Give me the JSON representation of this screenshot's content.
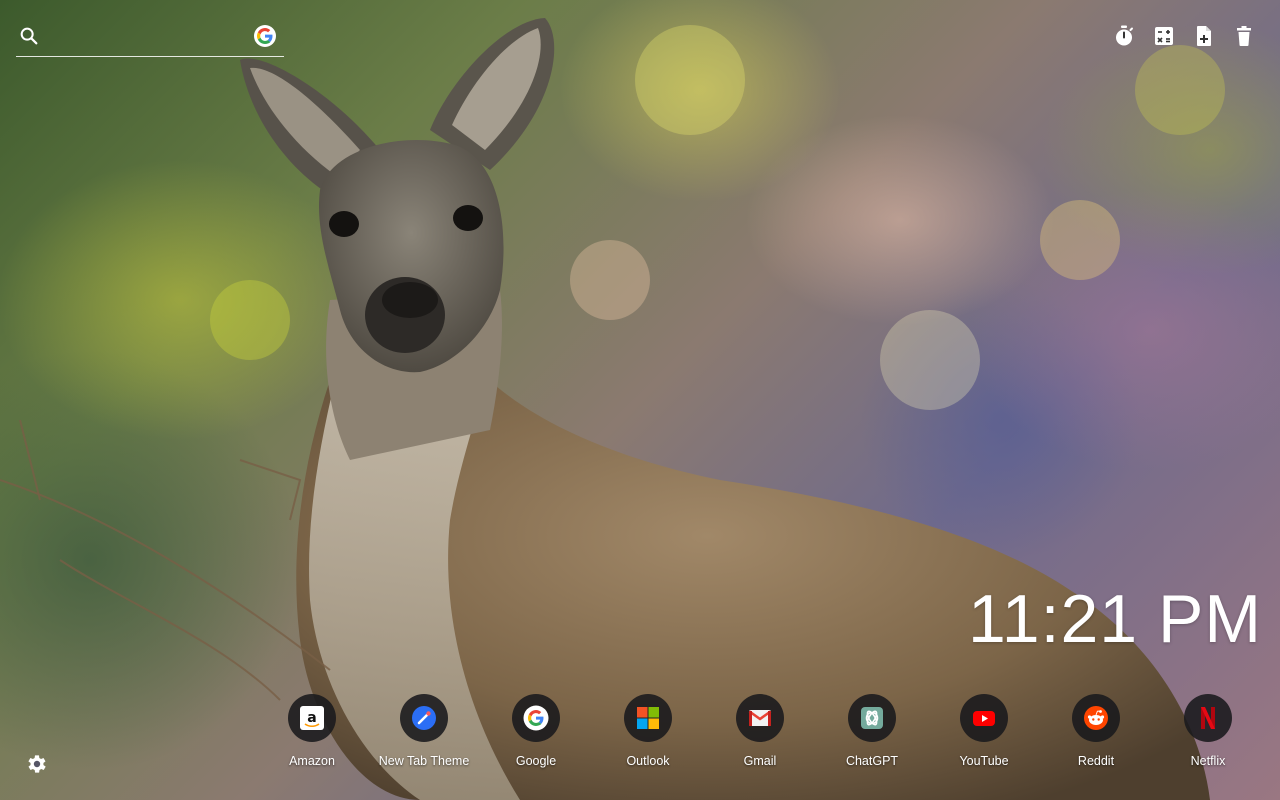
{
  "search": {
    "value": "",
    "placeholder": "",
    "icon": "search-icon",
    "engine_icon": "google-icon"
  },
  "toolbar": [
    {
      "name": "timer-button",
      "icon": "stopwatch-icon"
    },
    {
      "name": "calculator-button",
      "icon": "calculator-icon"
    },
    {
      "name": "new-note-button",
      "icon": "note-add-icon"
    },
    {
      "name": "delete-button",
      "icon": "trash-icon"
    }
  ],
  "clock": {
    "time": "11:21 PM"
  },
  "shortcuts": [
    {
      "label": "Amazon",
      "icon": "amazon-icon"
    },
    {
      "label": "New Tab Theme",
      "icon": "new-tab-theme-icon"
    },
    {
      "label": "Google",
      "icon": "google-icon"
    },
    {
      "label": "Outlook",
      "icon": "microsoft-icon"
    },
    {
      "label": "Gmail",
      "icon": "gmail-icon"
    },
    {
      "label": "ChatGPT",
      "icon": "chatgpt-icon"
    },
    {
      "label": "YouTube",
      "icon": "youtube-icon"
    },
    {
      "label": "Reddit",
      "icon": "reddit-icon"
    },
    {
      "label": "Netflix",
      "icon": "netflix-icon"
    }
  ],
  "settings": {
    "icon": "gear-icon"
  },
  "colors": {
    "text": "#ffffff",
    "shortcut_bg": "#1a1a1c",
    "youtube": "#ff0000",
    "netflix": "#e50914",
    "reddit": "#ff4500",
    "gmail": "#ea4335",
    "chatgpt": "#74aa9c"
  }
}
